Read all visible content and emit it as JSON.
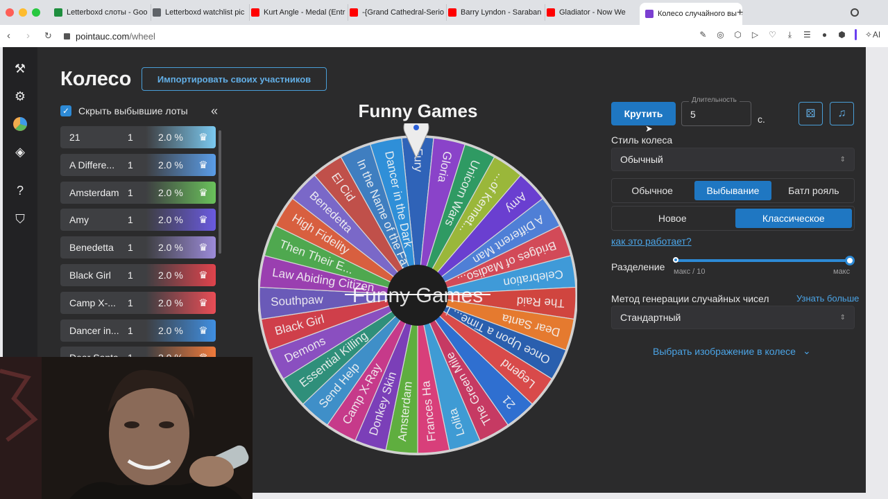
{
  "browser": {
    "tabs": [
      {
        "title": "Letterboxd слоты - Goo",
        "color": "#1e8e3e"
      },
      {
        "title": "Letterboxd watchlist pic",
        "color": "#5f6368"
      },
      {
        "title": "Kurt Angle - Medal (Entr",
        "color": "#ff0000"
      },
      {
        "title": "-{Grand Cathedral-Serio",
        "color": "#ff0000"
      },
      {
        "title": "Barry Lyndon - Saraban",
        "color": "#ff0000"
      },
      {
        "title": "Gladiator - Now We",
        "color": "#ff0000"
      },
      {
        "title": "Колесо случайного вы",
        "color": "#7b3fd1"
      }
    ],
    "url_host": "pointauc.com",
    "url_path": "/wheel",
    "ai_label": "AI"
  },
  "page": {
    "title": "Колесо",
    "import_button": "Импортировать своих участников",
    "hide_eliminated": "Скрыть выбывшие лоты",
    "collapse_icon": "«"
  },
  "lots": [
    {
      "name": "21",
      "amount": "1",
      "percent": "2.0 %",
      "color": "#7bc9f0"
    },
    {
      "name": "A Differe...",
      "amount": "1",
      "percent": "2.0 %",
      "color": "#5a9de8"
    },
    {
      "name": "Amsterdam",
      "amount": "1",
      "percent": "2.0 %",
      "color": "#6ac15b"
    },
    {
      "name": "Amy",
      "amount": "1",
      "percent": "2.0 %",
      "color": "#6a5ae0"
    },
    {
      "name": "Benedetta",
      "amount": "1",
      "percent": "2.0 %",
      "color": "#9c8bd9"
    },
    {
      "name": "Black Girl",
      "amount": "1",
      "percent": "2.0 %",
      "color": "#e0434c"
    },
    {
      "name": "Camp X-...",
      "amount": "1",
      "percent": "2.0 %",
      "color": "#e94d56"
    },
    {
      "name": "Dancer in...",
      "amount": "1",
      "percent": "2.0 %",
      "color": "#3f8fe2"
    },
    {
      "name": "Dear Santa",
      "amount": "1",
      "percent": "2.0 %",
      "color": "#ef7a3b"
    }
  ],
  "wheel": {
    "title": "Funny Games",
    "center_text": "Funny Games",
    "segments": [
      {
        "label": "Fury",
        "color": "#2f63b8"
      },
      {
        "label": "Gloria",
        "color": "#8a43c9"
      },
      {
        "label": "Unicorn Wars",
        "color": "#2f9a63"
      },
      {
        "label": "...of Kennet...",
        "color": "#9ab73a"
      },
      {
        "label": "Amy",
        "color": "#6a3fd0"
      },
      {
        "label": "A Different Man",
        "color": "#4f7fd6"
      },
      {
        "label": "Bridges of Madiso...",
        "color": "#d24a58"
      },
      {
        "label": "Celebration",
        "color": "#3f9ad8"
      },
      {
        "label": "The Raid",
        "color": "#d0453f"
      },
      {
        "label": "Dear Santa",
        "color": "#e57a2f"
      },
      {
        "label": "Once Upon a Time... i...",
        "color": "#2a5fae"
      },
      {
        "label": "Legend",
        "color": "#d84a4a"
      },
      {
        "label": "21",
        "color": "#2f6fd0"
      },
      {
        "label": "The Green Mile",
        "color": "#c63a63"
      },
      {
        "label": "Lolita",
        "color": "#3f9bd4"
      },
      {
        "label": "Frances Ha",
        "color": "#d83f7a"
      },
      {
        "label": "Amsterdam",
        "color": "#5fae3f"
      },
      {
        "label": "Donkey Skin",
        "color": "#7b3fb8"
      },
      {
        "label": "Camp X-Ray",
        "color": "#c63a8a"
      },
      {
        "label": "Send Help",
        "color": "#3f8fc8"
      },
      {
        "label": "Essential Killing",
        "color": "#2f8f7a"
      },
      {
        "label": "Demons",
        "color": "#8a4fc0"
      },
      {
        "label": "Black Girl",
        "color": "#cf3f4a"
      },
      {
        "label": "Southpaw",
        "color": "#6a5ab8"
      },
      {
        "label": "Law Abiding Citizen",
        "color": "#9a3fb0"
      },
      {
        "label": "Then Their E...",
        "color": "#4fa84f"
      },
      {
        "label": "High Fidelity",
        "color": "#d85f3f"
      },
      {
        "label": "Benedetta",
        "color": "#7a68c8"
      },
      {
        "label": "El Cid",
        "color": "#c0504a"
      },
      {
        "label": "In the Name of the Fa...",
        "color": "#3f7ec0"
      },
      {
        "label": "Dancer in the Dark",
        "color": "#2f8fd8"
      }
    ]
  },
  "controls": {
    "spin_button": "Крутить",
    "duration_label": "Длительность",
    "duration_value": "5",
    "seconds": "с.",
    "wheel_style_label": "Стиль колеса",
    "wheel_style_value": "Обычный",
    "modes": [
      "Обычное",
      "Выбывание",
      "Батл рояль"
    ],
    "active_mode": 1,
    "submodes": [
      "Новое",
      "Классическое"
    ],
    "active_submode": 1,
    "how_it_works": "как это работает?",
    "split_label": "Разделение",
    "split_min": "макс / 10",
    "split_max": "макс",
    "split_value": 1.0,
    "rng_label": "Метод генерации случайных чисел",
    "learn_more": "Узнать больше",
    "rng_value": "Стандартный",
    "choose_image": "Выбрать изображение в колесе"
  }
}
